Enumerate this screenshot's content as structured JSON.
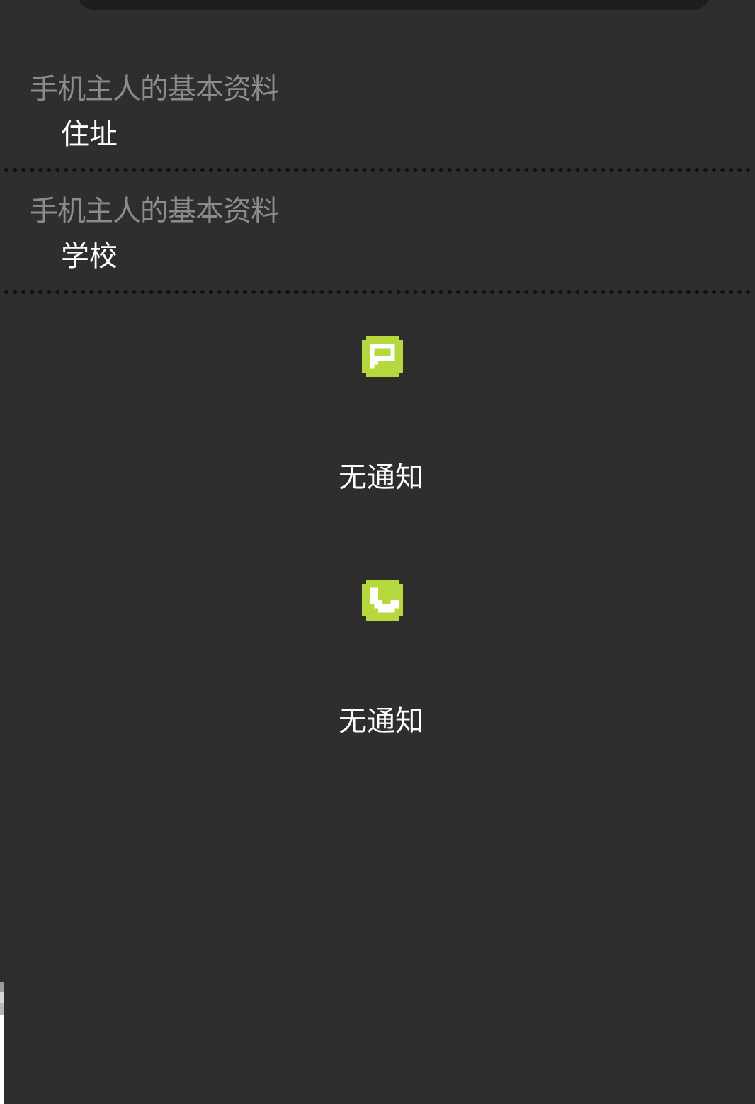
{
  "profile_items": [
    {
      "category": "手机主人的基本资料",
      "value": "住址"
    },
    {
      "category": "手机主人的基本资料",
      "value": "学校"
    }
  ],
  "notifications": [
    {
      "icon": "message-icon",
      "text": "无通知"
    },
    {
      "icon": "phone-icon",
      "text": "无通知"
    }
  ],
  "colors": {
    "background": "#2e2e2e",
    "accent": "#b5d83c",
    "category_text": "#8c8c8c",
    "value_text": "#ffffff",
    "divider": "#111111"
  }
}
